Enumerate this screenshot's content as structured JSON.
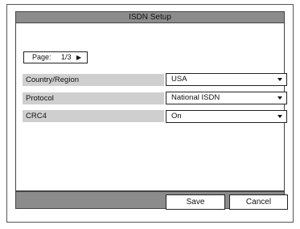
{
  "window": {
    "title": "ISDN Setup"
  },
  "pager": {
    "label": "Page:",
    "value": "1/3",
    "next_icon": "right-arrow-icon"
  },
  "settings": [
    {
      "label": "Country/Region",
      "value": "USA"
    },
    {
      "label": "Protocol",
      "value": "National ISDN"
    },
    {
      "label": "CRC4",
      "value": "On"
    }
  ],
  "buttons": {
    "save": "Save",
    "cancel": "Cancel"
  }
}
